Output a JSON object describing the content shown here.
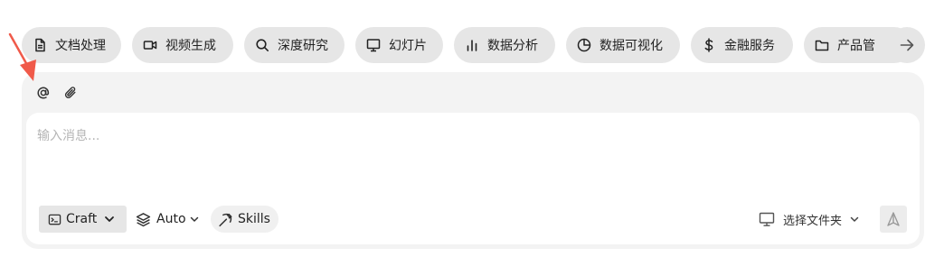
{
  "categories": [
    {
      "label": "文档处理",
      "icon": "document-icon"
    },
    {
      "label": "视频生成",
      "icon": "video-icon"
    },
    {
      "label": "深度研究",
      "icon": "search-icon"
    },
    {
      "label": "幻灯片",
      "icon": "monitor-icon"
    },
    {
      "label": "数据分析",
      "icon": "bar-chart-icon"
    },
    {
      "label": "数据可视化",
      "icon": "pie-chart-icon"
    },
    {
      "label": "金融服务",
      "icon": "dollar-icon"
    },
    {
      "label": "产品管",
      "icon": "folder-icon"
    }
  ],
  "composer": {
    "placeholder": "输入消息...",
    "mode_label": "Craft",
    "model_label": "Auto",
    "skills_label": "Skills",
    "folder_label": "选择文件夹"
  },
  "colors": {
    "chip_bg": "#e6e6e6",
    "composer_bg": "#f3f3f3",
    "pointer": "#f05a4a"
  }
}
